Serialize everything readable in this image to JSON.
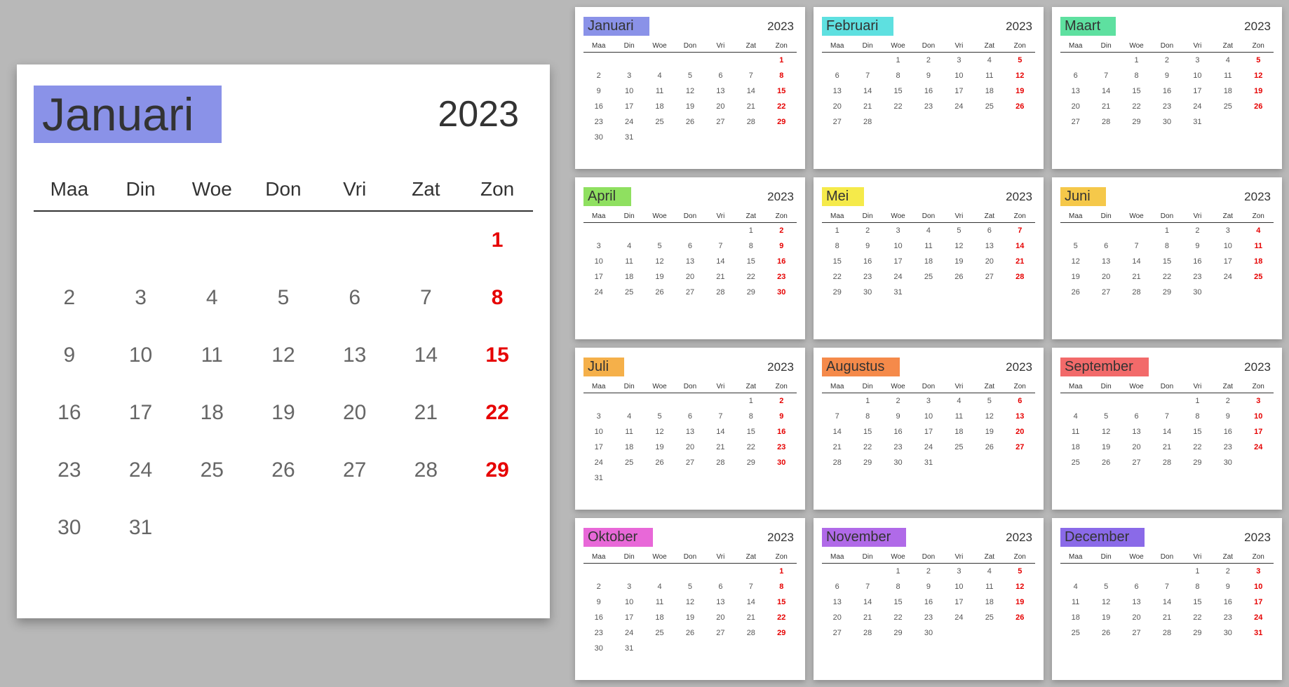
{
  "year": "2023",
  "weekdays": [
    "Maa",
    "Din",
    "Woe",
    "Don",
    "Vri",
    "Zat",
    "Zon"
  ],
  "main": {
    "month": "Januari",
    "color": "#8a92e8",
    "startDay": 6,
    "days": 31
  },
  "months": [
    {
      "name": "Januari",
      "color": "#8a92e8",
      "startDay": 6,
      "days": 31
    },
    {
      "name": "Februari",
      "color": "#5ee0e0",
      "startDay": 2,
      "days": 28
    },
    {
      "name": "Maart",
      "color": "#5ee0a0",
      "startDay": 2,
      "days": 31
    },
    {
      "name": "April",
      "color": "#8fe060",
      "startDay": 5,
      "days": 30
    },
    {
      "name": "Mei",
      "color": "#f5ea4a",
      "startDay": 0,
      "days": 31
    },
    {
      "name": "Juni",
      "color": "#f5c84a",
      "startDay": 3,
      "days": 30
    },
    {
      "name": "Juli",
      "color": "#f5b04a",
      "startDay": 5,
      "days": 31
    },
    {
      "name": "Augustus",
      "color": "#f58a4a",
      "startDay": 1,
      "days": 31
    },
    {
      "name": "September",
      "color": "#f26a6a",
      "startDay": 4,
      "days": 30
    },
    {
      "name": "Oktober",
      "color": "#e868d8",
      "startDay": 6,
      "days": 31
    },
    {
      "name": "November",
      "color": "#b06ae8",
      "startDay": 2,
      "days": 30
    },
    {
      "name": "December",
      "color": "#8a6ae8",
      "startDay": 4,
      "days": 31
    }
  ]
}
